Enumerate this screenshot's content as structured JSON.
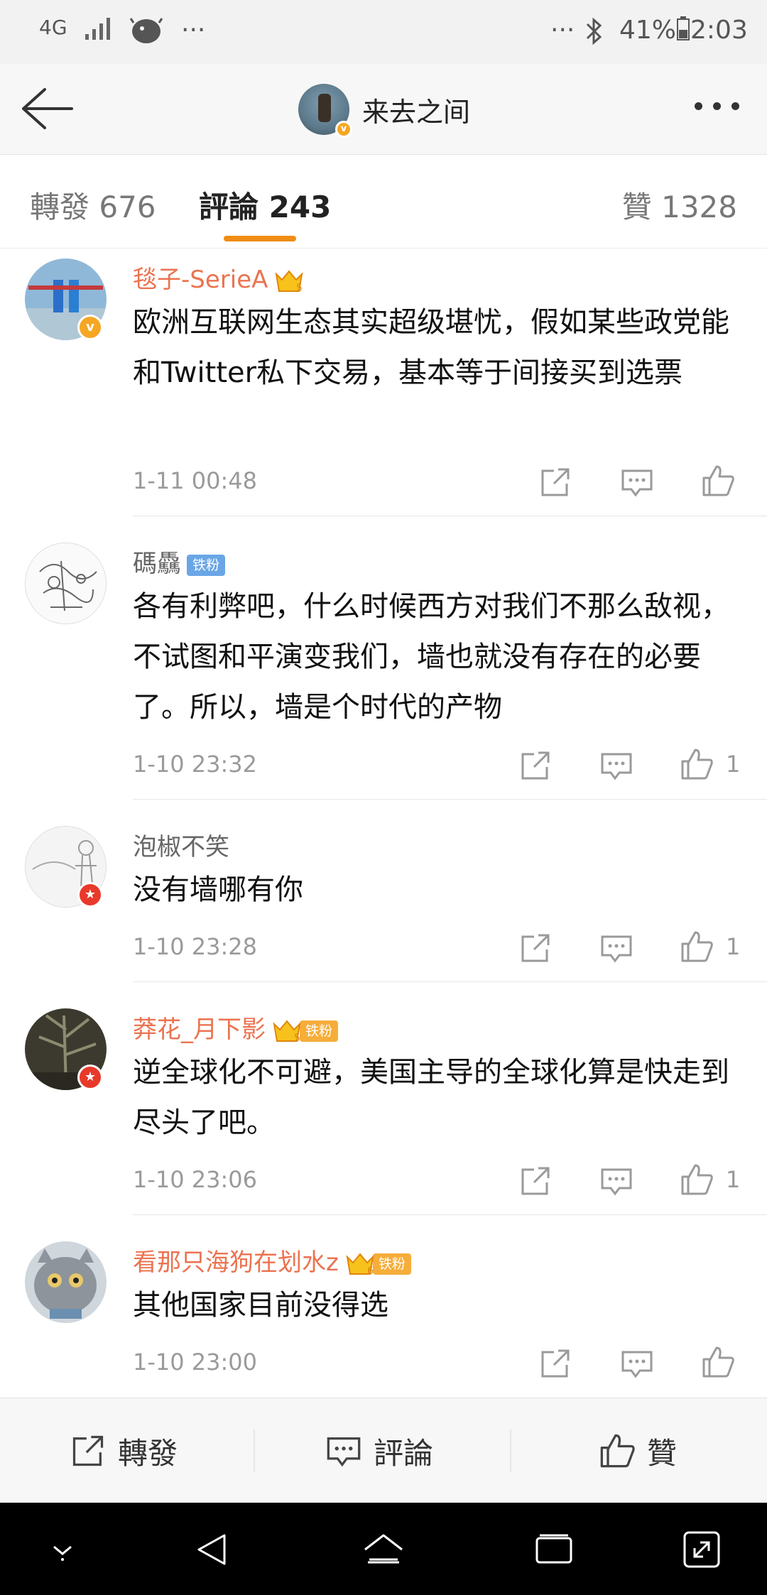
{
  "status_bar": {
    "network": "4G",
    "left_dots": "···",
    "right_dots": "···",
    "battery": "41%",
    "time": "2:03"
  },
  "header": {
    "title": "来去之间"
  },
  "tabs": [
    {
      "label": "轉發 676"
    },
    {
      "label": "評論 243"
    },
    {
      "label": "贊 1328"
    }
  ],
  "comments": [
    {
      "name": "毯子-SerieA",
      "text": "欧洲互联网生态其实超级堪忧，假如某些政党能和Twitter私下交易，基本等于间接买到选票",
      "time": "1-11 00:48",
      "likes": ""
    },
    {
      "name": "碼驫",
      "fan_tag": "铁粉",
      "text": "各有利弊吧，什么时候西方对我们不那么敌视，不试图和平演变我们，墙也就没有存在的必要了。所以，墙是个时代的产物",
      "time": "1-10 23:32",
      "likes": "1"
    },
    {
      "name": "泡椒不笑",
      "text": "没有墙哪有你",
      "time": "1-10 23:28",
      "likes": "1"
    },
    {
      "name": "莽花_月下影",
      "fan_tag": "铁粉",
      "text": "逆全球化不可避，美国主导的全球化算是快走到尽头了吧。",
      "time": "1-10 23:06",
      "likes": "1"
    },
    {
      "name": "看那只海狗在划水z",
      "fan_tag": "铁粉",
      "text": "其他国家目前没得选",
      "time": "1-10 23:00",
      "likes": ""
    }
  ],
  "bottom_bar": {
    "repost": "轉發",
    "comment": "評論",
    "like": "贊"
  },
  "colors": {
    "accent": "#f08c14",
    "vip_name": "#eb7350",
    "verified": "#f5a623"
  }
}
